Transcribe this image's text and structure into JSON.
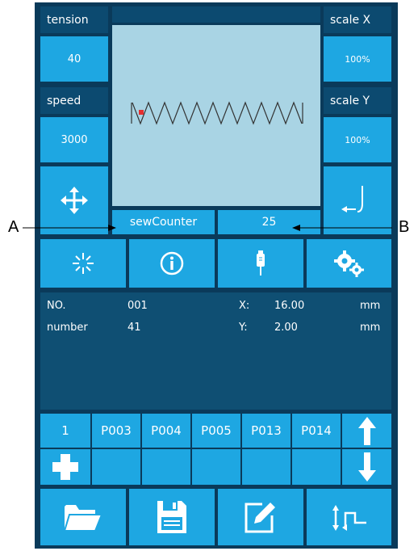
{
  "left_panel": {
    "tension_label": "tension",
    "tension_value": "40",
    "speed_label": "speed",
    "speed_value": "3000"
  },
  "right_panel": {
    "scale_x_label": "scale X",
    "scale_x_value": "100%",
    "scale_y_label": "scale Y",
    "scale_y_value": "100%"
  },
  "counter": {
    "label": "sewCounter",
    "value": "25"
  },
  "callouts": {
    "a": "A",
    "b": "B"
  },
  "info": {
    "no_label": "NO.",
    "no_value": "001",
    "number_label": "number",
    "number_value": "41",
    "x_label": "X:",
    "x_value": "16.00",
    "x_unit": "mm",
    "y_label": "Y:",
    "y_value": "2.00",
    "y_unit": "mm"
  },
  "patterns": {
    "selected": "1",
    "items": [
      "P003",
      "P004",
      "P005",
      "P013",
      "P014"
    ]
  },
  "icons": {
    "move": "move-arrows-icon",
    "needle_return": "needle-return-icon",
    "sparkle": "sparkle-icon",
    "info": "info-icon",
    "thread": "thread-icon",
    "gears": "gears-icon",
    "plus": "plus-icon",
    "up": "arrow-up-icon",
    "down": "arrow-down-icon",
    "folder": "folder-icon",
    "save": "save-icon",
    "edit": "edit-icon",
    "origin": "origin-return-icon"
  },
  "colors": {
    "button": "#1ea7e2",
    "dark_label": "#0c4a70",
    "info_bg": "#0f4f73",
    "preview_bg": "#a9d4e4",
    "stitch_marker": "#e53030"
  }
}
